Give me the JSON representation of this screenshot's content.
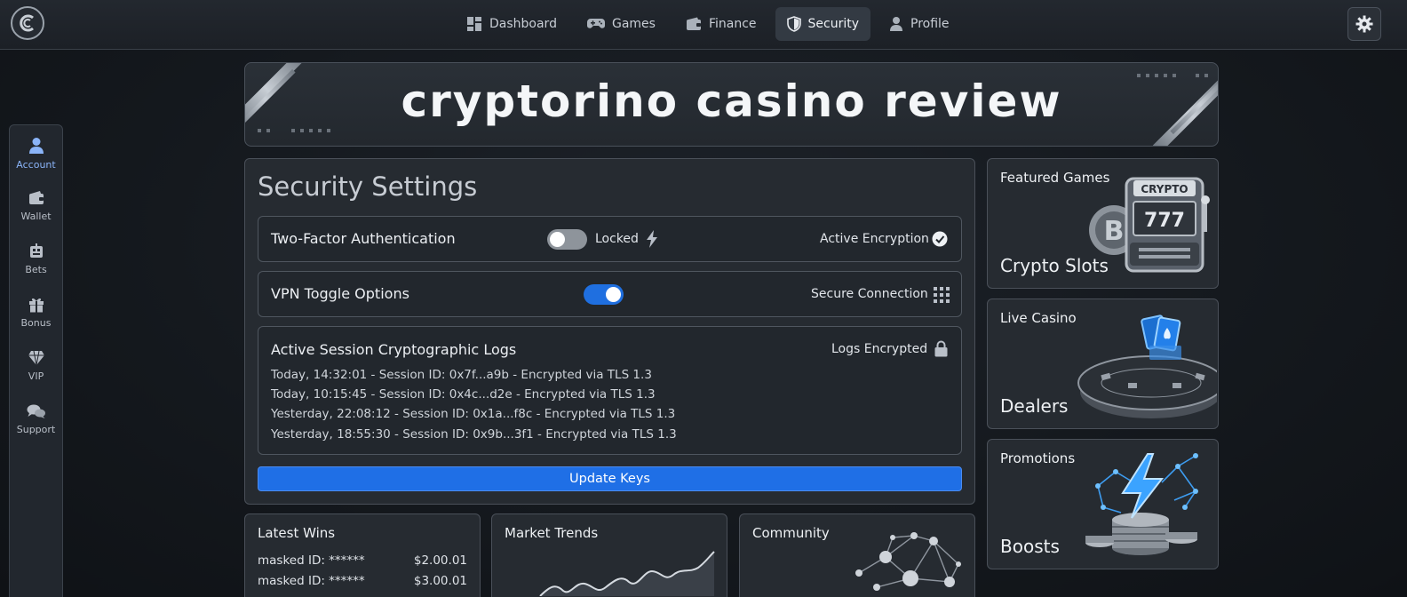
{
  "nav": {
    "items": [
      {
        "label": "Dashboard",
        "icon": "dashboard-icon"
      },
      {
        "label": "Games",
        "icon": "gamepad-icon"
      },
      {
        "label": "Finance",
        "icon": "wallet-icon"
      },
      {
        "label": "Security",
        "icon": "shield-icon",
        "active": true
      },
      {
        "label": "Profile",
        "icon": "user-icon"
      }
    ]
  },
  "sidebar": {
    "items": [
      {
        "label": "Account",
        "icon": "user-icon",
        "active": true
      },
      {
        "label": "Wallet",
        "icon": "wallet-icon"
      },
      {
        "label": "Bets",
        "icon": "robot-icon"
      },
      {
        "label": "Bonus",
        "icon": "gift-icon"
      },
      {
        "label": "VIP",
        "icon": "diamond-icon"
      },
      {
        "label": "Support",
        "icon": "chat-icon"
      }
    ]
  },
  "banner": {
    "title": "cryptorino casino review"
  },
  "security": {
    "title": "Security Settings",
    "two_factor": {
      "label": "Two-Factor Authentication",
      "state_label": "Locked",
      "status": "Active Encryption",
      "enabled": false
    },
    "vpn": {
      "label": "VPN Toggle Options",
      "status": "Secure Connection",
      "enabled": true
    },
    "logs": {
      "title": "Active Session Cryptographic Logs",
      "status": "Logs Encrypted",
      "entries": [
        "Today, 14:32:01 - Session ID: 0x7f...a9b - Encrypted via TLS 1.3",
        "Today, 10:15:45 - Session ID: 0x4c...d2e - Encrypted via TLS 1.3",
        "Yesterday, 22:08:12 - Session ID: 0x1a...f8c - Encrypted via TLS 1.3",
        "Yesterday, 18:55:30 - Session ID: 0x9b...3f1 - Encrypted via TLS 1.3"
      ]
    },
    "update_button": "Update Keys"
  },
  "latest_wins": {
    "title": "Latest Wins",
    "rows": [
      {
        "user": "masked ID: ******",
        "amount": "$2.00.01"
      },
      {
        "user": "masked ID: ******",
        "amount": "$3.00.01"
      }
    ]
  },
  "market_trends": {
    "title": "Market Trends"
  },
  "community": {
    "title": "Community"
  },
  "featured": [
    {
      "title": "Featured Games",
      "name": "Crypto Slots",
      "art_label": "CRYPTO"
    },
    {
      "title": "Live Casino",
      "name": "Dealers"
    },
    {
      "title": "Promotions",
      "name": "Boosts"
    }
  ],
  "colors": {
    "accent": "#1f6fe6",
    "panel": "#262b31",
    "background": "#14181d"
  }
}
